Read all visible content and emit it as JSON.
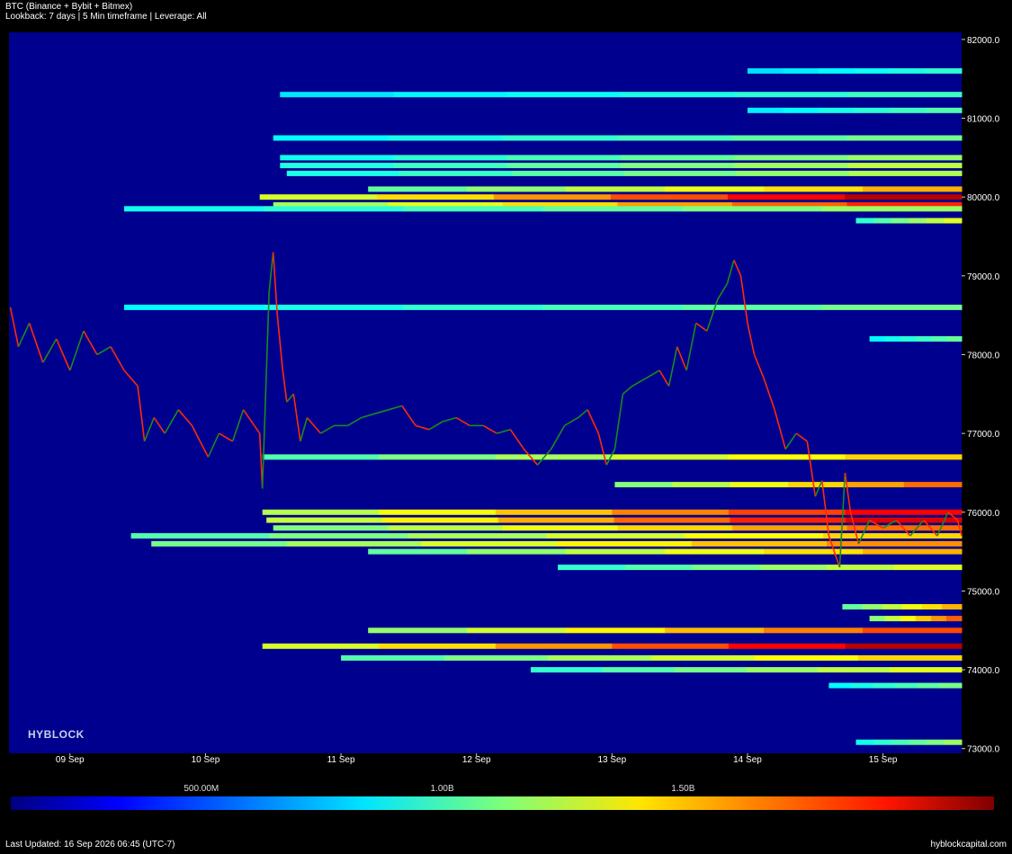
{
  "header": {
    "title": "BTC (Binance + Bybit + Bitmex)",
    "subtitle": "Lookback: 7 days | 5 Min timeframe | Leverage: All"
  },
  "footer": {
    "last_updated": "Last Updated: 16 Sep 2026 06:45 (UTC-7)",
    "site": "hyblockcapital.com"
  },
  "brand": "HYBLOCK",
  "colorbar": {
    "labels": [
      {
        "text": "500.00M",
        "value": 500000000
      },
      {
        "text": "1.00B",
        "value": 1000000000
      },
      {
        "text": "1.50B",
        "value": 1500000000
      }
    ],
    "min": 0,
    "max": 2000000000
  },
  "colors": {
    "background": "#000000",
    "plot_bg": "#00008f",
    "price_up": "#1a8a1a",
    "price_down": "#ff2a00"
  },
  "chart_data": {
    "type": "heatmap",
    "title": "",
    "xlabel": "",
    "ylabel": "",
    "x_ticks": [
      "09 Sep",
      "10 Sep",
      "11 Sep",
      "12 Sep",
      "13 Sep",
      "14 Sep",
      "15 Sep"
    ],
    "x_range_days": [
      8.55,
      15.58
    ],
    "ylim": [
      72940,
      82090
    ],
    "y_ticks": [
      73000.0,
      74000.0,
      75000.0,
      76000.0,
      77000.0,
      78000.0,
      79000.0,
      80000.0,
      81000.0,
      82000.0
    ],
    "price_series": [
      [
        8.56,
        78600
      ],
      [
        8.62,
        78100
      ],
      [
        8.7,
        78400
      ],
      [
        8.8,
        77900
      ],
      [
        8.9,
        78200
      ],
      [
        9.0,
        77800
      ],
      [
        9.1,
        78300
      ],
      [
        9.2,
        78000
      ],
      [
        9.3,
        78100
      ],
      [
        9.4,
        77800
      ],
      [
        9.5,
        77600
      ],
      [
        9.55,
        76900
      ],
      [
        9.62,
        77200
      ],
      [
        9.7,
        77000
      ],
      [
        9.8,
        77300
      ],
      [
        9.9,
        77100
      ],
      [
        9.96,
        76900
      ],
      [
        10.02,
        76700
      ],
      [
        10.1,
        77000
      ],
      [
        10.2,
        76900
      ],
      [
        10.28,
        77300
      ],
      [
        10.36,
        77100
      ],
      [
        10.4,
        77000
      ],
      [
        10.42,
        76300
      ],
      [
        10.47,
        78800
      ],
      [
        10.5,
        79300
      ],
      [
        10.53,
        78500
      ],
      [
        10.57,
        77800
      ],
      [
        10.6,
        77400
      ],
      [
        10.65,
        77500
      ],
      [
        10.7,
        76900
      ],
      [
        10.75,
        77200
      ],
      [
        10.85,
        77000
      ],
      [
        10.95,
        77100
      ],
      [
        11.05,
        77100
      ],
      [
        11.15,
        77200
      ],
      [
        11.25,
        77250
      ],
      [
        11.35,
        77300
      ],
      [
        11.45,
        77350
      ],
      [
        11.55,
        77100
      ],
      [
        11.65,
        77050
      ],
      [
        11.75,
        77150
      ],
      [
        11.85,
        77200
      ],
      [
        11.95,
        77100
      ],
      [
        12.05,
        77100
      ],
      [
        12.15,
        77000
      ],
      [
        12.25,
        77050
      ],
      [
        12.35,
        76800
      ],
      [
        12.45,
        76600
      ],
      [
        12.55,
        76800
      ],
      [
        12.65,
        77100
      ],
      [
        12.75,
        77200
      ],
      [
        12.82,
        77300
      ],
      [
        12.9,
        77000
      ],
      [
        12.96,
        76600
      ],
      [
        13.02,
        76800
      ],
      [
        13.08,
        77500
      ],
      [
        13.15,
        77600
      ],
      [
        13.25,
        77700
      ],
      [
        13.35,
        77800
      ],
      [
        13.42,
        77600
      ],
      [
        13.48,
        78100
      ],
      [
        13.55,
        77800
      ],
      [
        13.62,
        78400
      ],
      [
        13.7,
        78300
      ],
      [
        13.78,
        78700
      ],
      [
        13.85,
        78900
      ],
      [
        13.9,
        79200
      ],
      [
        13.95,
        79000
      ],
      [
        14.0,
        78400
      ],
      [
        14.05,
        78000
      ],
      [
        14.12,
        77700
      ],
      [
        14.2,
        77300
      ],
      [
        14.28,
        76800
      ],
      [
        14.36,
        77000
      ],
      [
        14.44,
        76900
      ],
      [
        14.5,
        76200
      ],
      [
        14.55,
        76400
      ],
      [
        14.6,
        75700
      ],
      [
        14.68,
        75300
      ],
      [
        14.72,
        76500
      ],
      [
        14.76,
        76000
      ],
      [
        14.82,
        75600
      ],
      [
        14.9,
        75900
      ],
      [
        15.0,
        75800
      ],
      [
        15.1,
        75900
      ],
      [
        15.2,
        75700
      ],
      [
        15.3,
        75900
      ],
      [
        15.4,
        75700
      ],
      [
        15.48,
        76000
      ],
      [
        15.55,
        75900
      ],
      [
        15.58,
        75700
      ]
    ],
    "liquidation_bands": [
      {
        "price": 80000,
        "x_start": 10.4,
        "intensity": 0.95
      },
      {
        "price": 79900,
        "x_start": 10.5,
        "intensity": 0.8
      },
      {
        "price": 80100,
        "x_start": 11.2,
        "intensity": 0.6
      },
      {
        "price": 79700,
        "x_start": 14.8,
        "intensity": 0.45
      },
      {
        "price": 79850,
        "x_start": 9.4,
        "intensity": 0.35
      },
      {
        "price": 80400,
        "x_start": 10.55,
        "intensity": 0.4
      },
      {
        "price": 80300,
        "x_start": 10.6,
        "intensity": 0.38
      },
      {
        "price": 80500,
        "x_start": 10.55,
        "intensity": 0.35
      },
      {
        "price": 80750,
        "x_start": 10.5,
        "intensity": 0.3
      },
      {
        "price": 81100,
        "x_start": 14.0,
        "intensity": 0.25
      },
      {
        "price": 81300,
        "x_start": 10.55,
        "intensity": 0.22
      },
      {
        "price": 81600,
        "x_start": 14.0,
        "intensity": 0.2
      },
      {
        "price": 78600,
        "x_start": 9.4,
        "intensity": 0.3
      },
      {
        "price": 78200,
        "x_start": 14.9,
        "intensity": 0.28
      },
      {
        "price": 76700,
        "x_start": 10.42,
        "intensity": 0.55
      },
      {
        "price": 76350,
        "x_start": 13.02,
        "intensity": 0.7
      },
      {
        "price": 76000,
        "x_start": 10.42,
        "intensity": 0.85
      },
      {
        "price": 75900,
        "x_start": 10.45,
        "intensity": 0.9
      },
      {
        "price": 75800,
        "x_start": 10.5,
        "intensity": 0.7
      },
      {
        "price": 75700,
        "x_start": 9.45,
        "intensity": 0.55
      },
      {
        "price": 75600,
        "x_start": 9.6,
        "intensity": 0.65
      },
      {
        "price": 75500,
        "x_start": 11.2,
        "intensity": 0.6
      },
      {
        "price": 75300,
        "x_start": 12.6,
        "intensity": 0.45
      },
      {
        "price": 74800,
        "x_start": 14.7,
        "intensity": 0.6
      },
      {
        "price": 74650,
        "x_start": 14.9,
        "intensity": 0.72
      },
      {
        "price": 74500,
        "x_start": 11.2,
        "intensity": 0.75
      },
      {
        "price": 74300,
        "x_start": 10.42,
        "intensity": 0.95
      },
      {
        "price": 74150,
        "x_start": 11.0,
        "intensity": 0.55
      },
      {
        "price": 74000,
        "x_start": 12.4,
        "intensity": 0.45
      },
      {
        "price": 73800,
        "x_start": 14.6,
        "intensity": 0.3
      },
      {
        "price": 73080,
        "x_start": 14.8,
        "intensity": 0.35
      }
    ]
  }
}
